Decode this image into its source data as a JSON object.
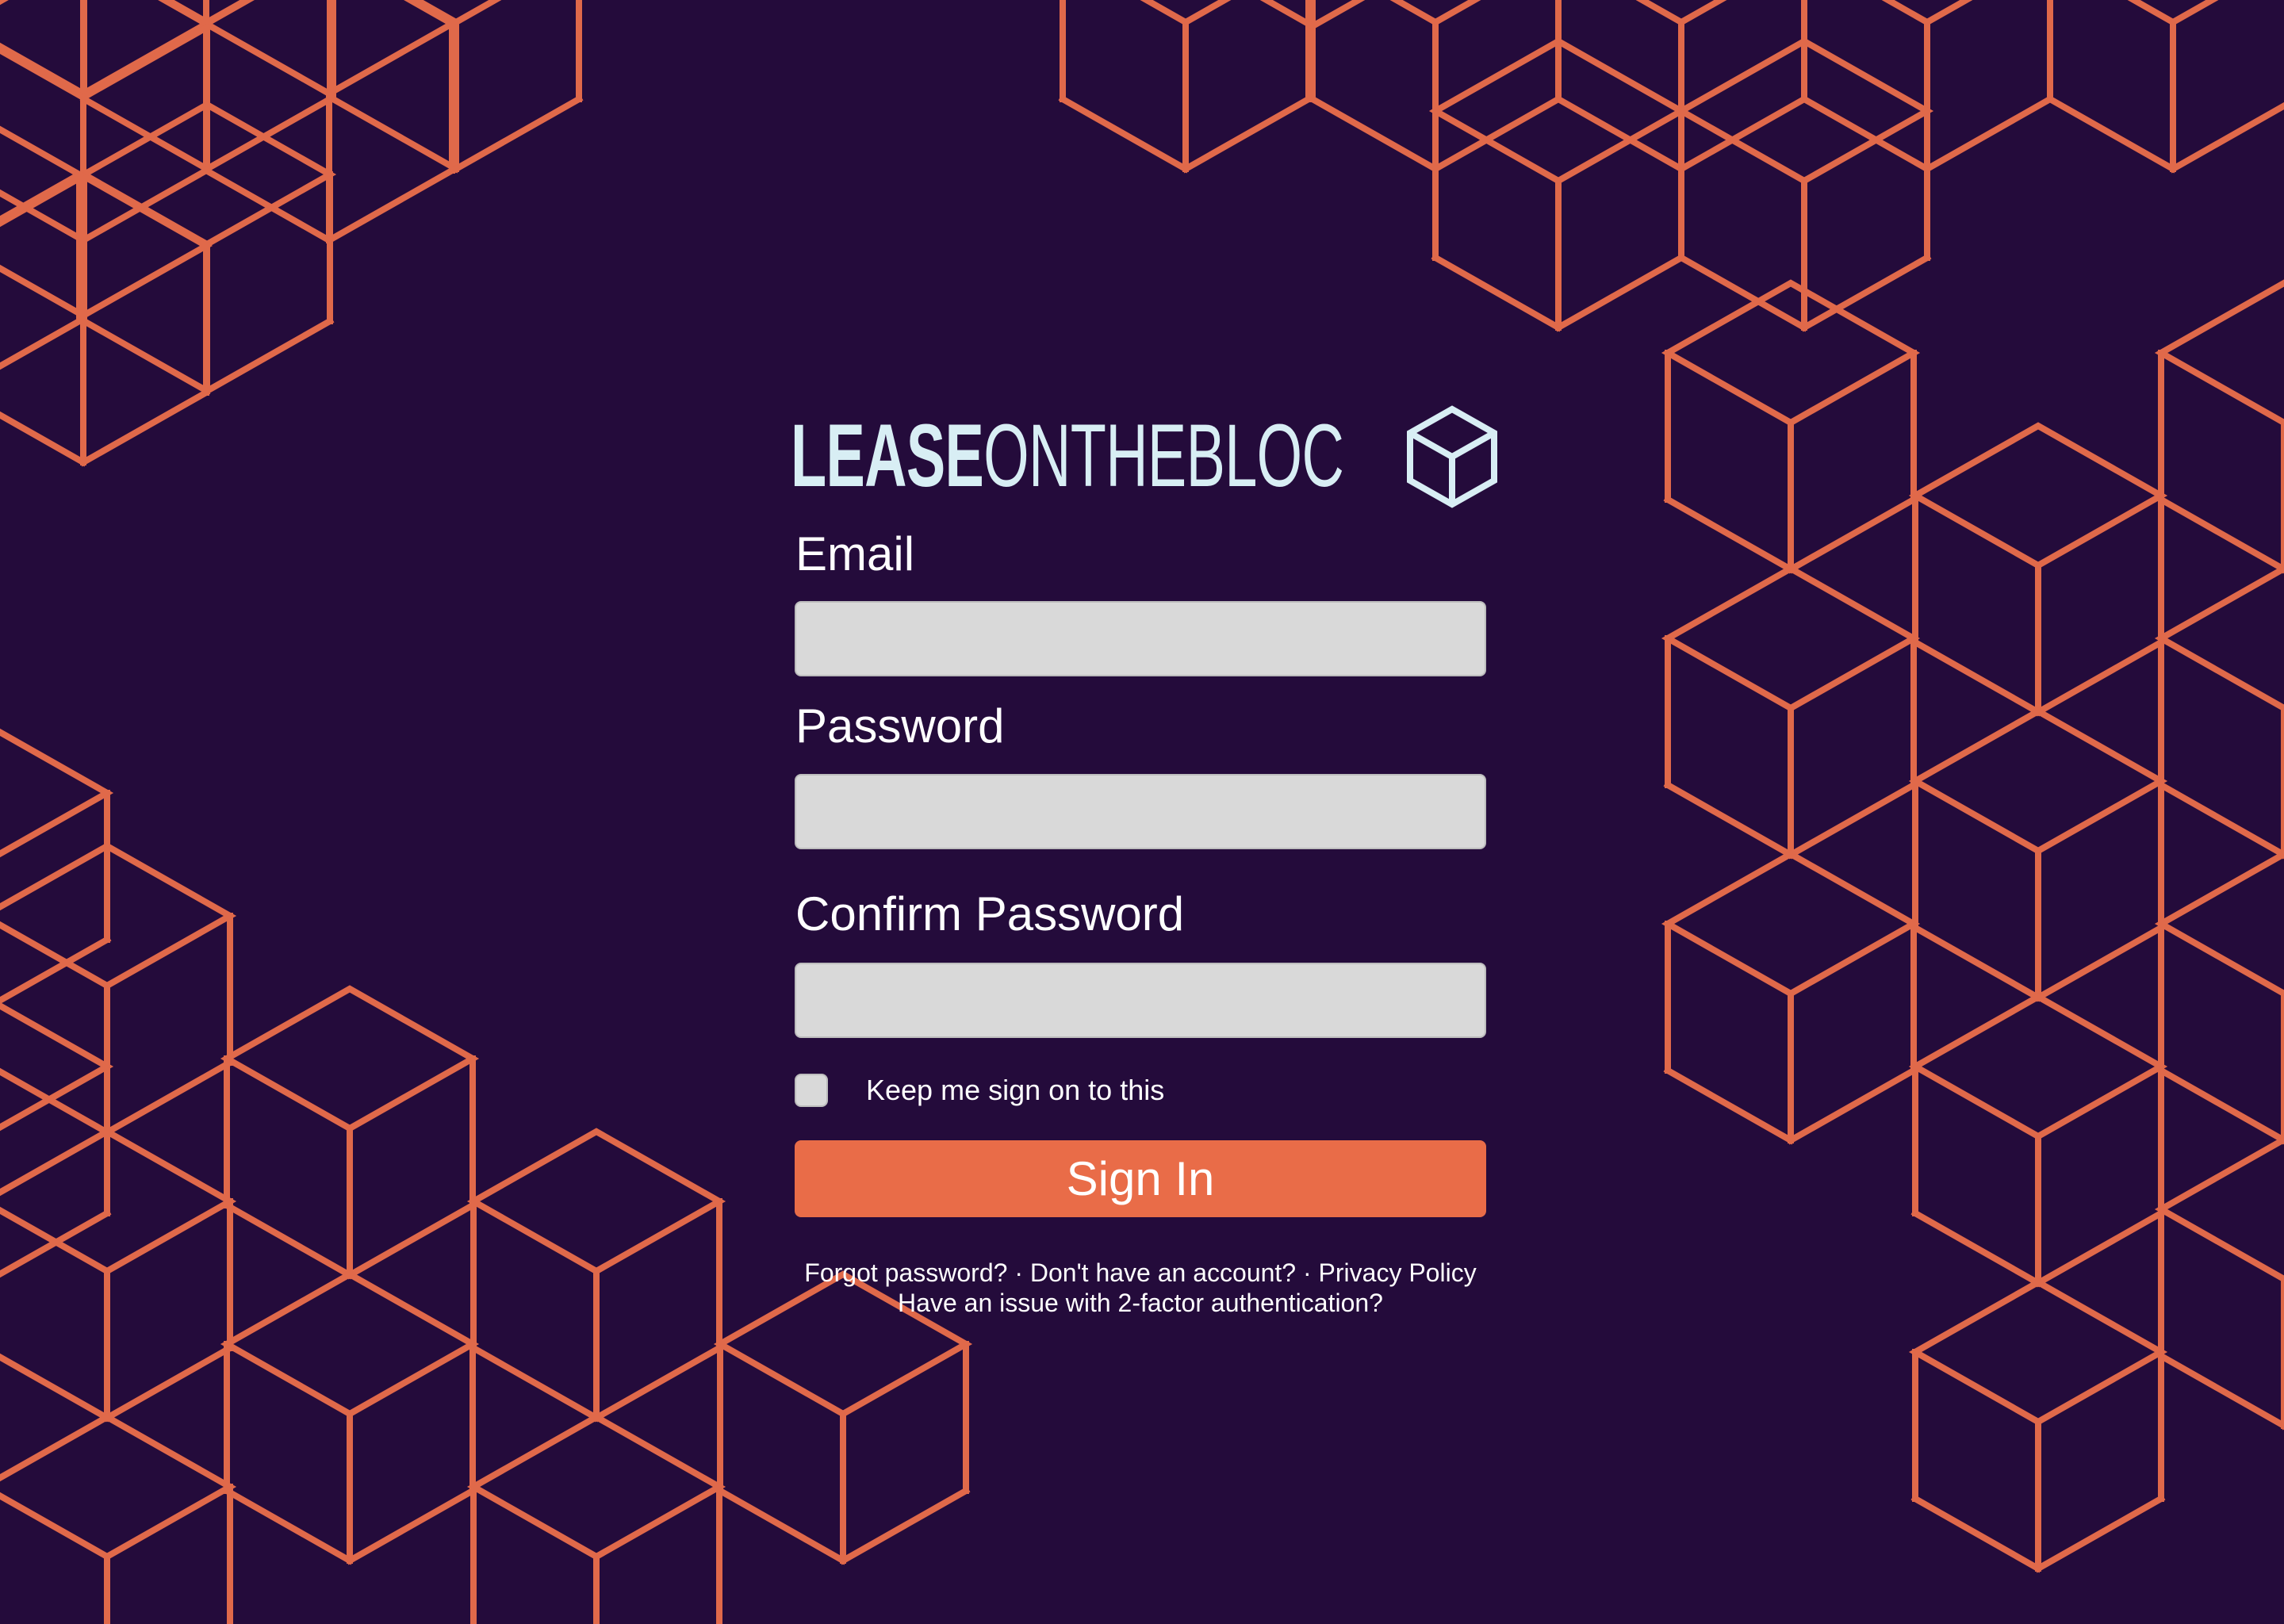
{
  "app": {
    "logo_bold": "LEASE",
    "logo_light": "ONTHEBLOC",
    "logo_icon": "cube-icon"
  },
  "form": {
    "email_label": "Email",
    "email_value": "",
    "password_label": "Password",
    "password_value": "",
    "confirm_password_label": "Confirm Password",
    "confirm_password_value": "",
    "keep_signed_in_label": "Keep me sign on to this",
    "keep_signed_in_checked": false,
    "submit_label": "Sign In"
  },
  "footer": {
    "forgot_password": "Forgot password?",
    "no_account": "Don't have an account?",
    "privacy_policy": "Privacy Policy",
    "two_factor_issue": "Have an issue with 2-factor authentication?",
    "separator": "·"
  },
  "colors": {
    "background": "#240b3b",
    "accent": "#e96c48",
    "pattern_stroke": "#e0694a",
    "logo": "#d8eef4",
    "input_fill": "#d9d9d9"
  }
}
